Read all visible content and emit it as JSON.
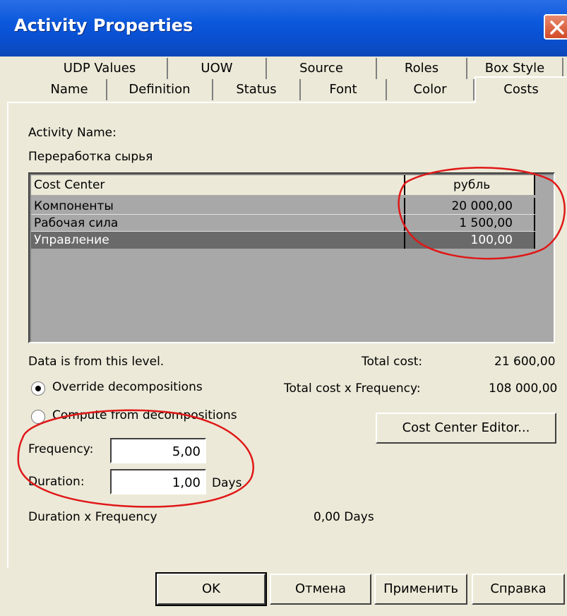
{
  "window": {
    "title": "Activity Properties"
  },
  "tabs": {
    "back_row": [
      "UDP Values",
      "UOW",
      "Source",
      "Roles",
      "Box Style"
    ],
    "front_row": [
      "Name",
      "Definition",
      "Status",
      "Font",
      "Color"
    ],
    "active": "Costs"
  },
  "content": {
    "activity_name_label": "Activity Name:",
    "activity_name_value": "Переработка сырья",
    "table": {
      "headers": [
        "Cost Center",
        "рубль"
      ],
      "rows": [
        {
          "name": "Компоненты",
          "value": "20 000,00"
        },
        {
          "name": "Рабочая сила",
          "value": "1 500,00"
        },
        {
          "name": "Управление",
          "value": "100,00",
          "selected": true
        }
      ]
    },
    "data_level_text": "Data is from this level.",
    "total_cost_label": "Total cost:",
    "total_cost_value": "21 600,00",
    "total_freq_label": "Total cost x Frequency:",
    "total_freq_value": "108 000,00",
    "radio_override": "Override decompositions",
    "radio_compute": "Compute from decompositions",
    "cost_center_editor": "Cost Center Editor...",
    "frequency_label": "Frequency:",
    "frequency_value": "5,00",
    "duration_label": "Duration:",
    "duration_value": "1,00",
    "duration_unit": "Days",
    "duration_freq_label": "Duration x Frequency",
    "duration_freq_value": "0,00 Days"
  },
  "buttons": {
    "ok": "OK",
    "cancel": "Отмена",
    "apply": "Применить",
    "help": "Справка"
  },
  "colors": {
    "titlebar": "#0b58dc",
    "annotation": "#e01818",
    "dialog_bg": "#ece9d8"
  }
}
